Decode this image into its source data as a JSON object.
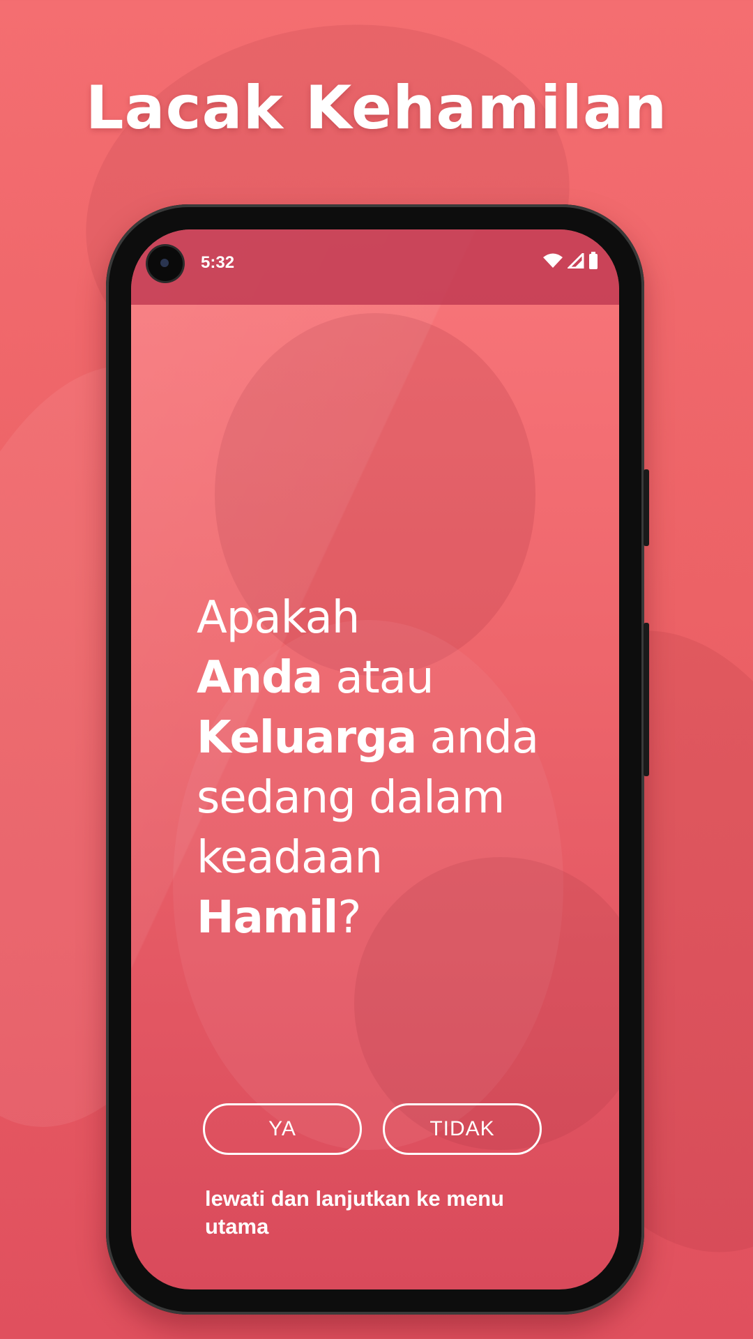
{
  "promo": {
    "headline": "Lacak Kehamilan"
  },
  "status_bar": {
    "time": "5:32",
    "icons": [
      "wifi-icon",
      "signal-icon",
      "battery-icon"
    ]
  },
  "question": {
    "line1": "Apakah",
    "line2_bold": "Anda",
    "line2_rest": " atau",
    "line3_bold": "Keluarga",
    "line3_rest": " anda",
    "line4": "sedang dalam",
    "line5": "keadaan",
    "line6_bold": "Hamil",
    "line6_rest": "?"
  },
  "buttons": {
    "yes_label": "YA",
    "no_label": "TIDAK"
  },
  "skip": {
    "label": "lewati dan lanjutkan ke menu utama"
  },
  "colors": {
    "background": "#ec6266",
    "status_bar": "#c0375a",
    "text": "#ffffff",
    "phone_frame": "#0d0d0d"
  }
}
